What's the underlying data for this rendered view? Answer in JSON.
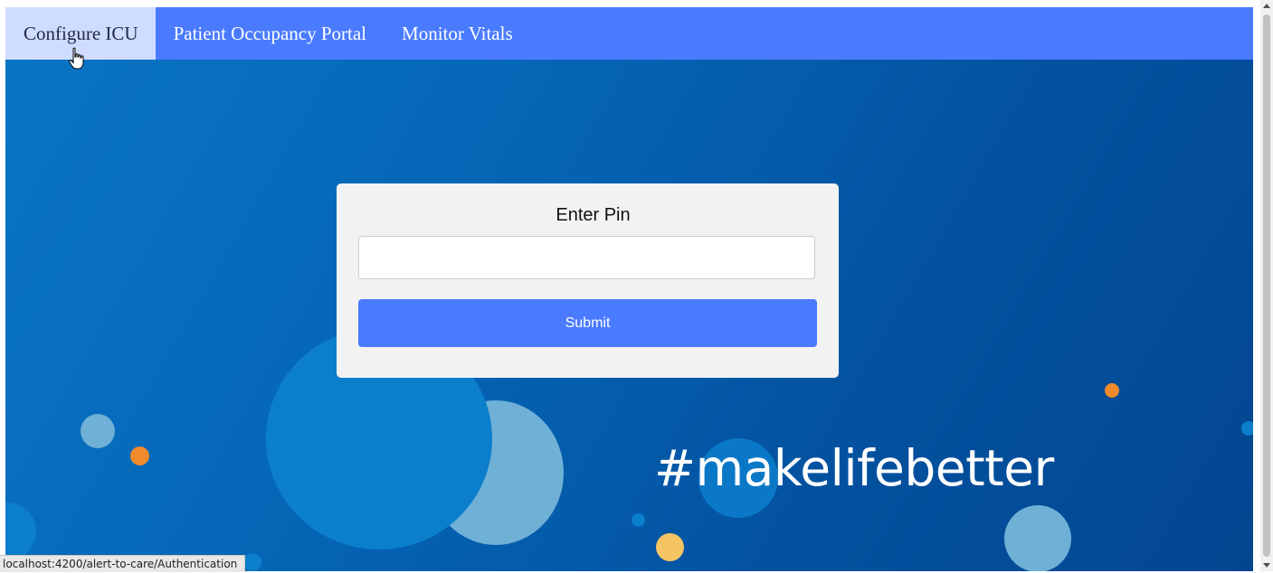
{
  "nav": {
    "items": [
      {
        "label": "Configure ICU",
        "active": true
      },
      {
        "label": "Patient Occupancy Portal",
        "active": false
      },
      {
        "label": "Monitor Vitals",
        "active": false
      }
    ]
  },
  "hero": {
    "hashtag": "#makelifebetter"
  },
  "pin_form": {
    "title": "Enter Pin",
    "input_value": "",
    "submit_label": "Submit"
  },
  "status_bar": {
    "url": "localhost:4200/alert-to-care/Authentication"
  },
  "colors": {
    "nav_background": "#4a7bff",
    "nav_active_background": "#cfdcff",
    "submit_background": "#4a7bff",
    "card_background": "#f2f2f2",
    "hero_blue": "#0566b6"
  }
}
